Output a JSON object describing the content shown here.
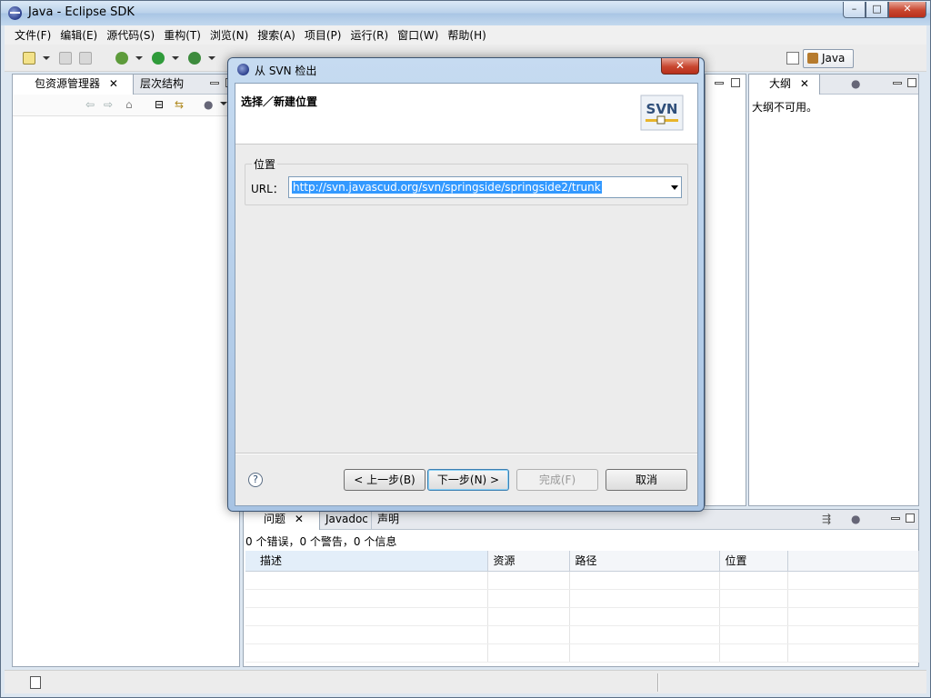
{
  "window": {
    "title": "Java  -  Eclipse SDK"
  },
  "menu": [
    "文件(F)",
    "编辑(E)",
    "源代码(S)",
    "重构(T)",
    "浏览(N)",
    "搜索(A)",
    "项目(P)",
    "运行(R)",
    "窗口(W)",
    "帮助(H)"
  ],
  "perspective": {
    "label": "Java"
  },
  "views": {
    "package_explorer": {
      "tab": "包资源管理器",
      "tab2": "层次结构"
    },
    "outline": {
      "tab": "大纲",
      "message": "大纲不可用。"
    },
    "problems": {
      "tabs": [
        "问题",
        "Javadoc",
        "声明"
      ],
      "summary": "0 个错误，0 个警告，0 个信息",
      "columns": [
        "描述",
        "资源",
        "路径",
        "位置"
      ]
    }
  },
  "dialog": {
    "title": "从 SVN 检出",
    "banner_title": "选择／新建位置",
    "logo_text": "SVN",
    "group_label": "位置",
    "url_label": "URL：",
    "url_value": "http://svn.javascud.org/svn/springside/springside2/trunk",
    "buttons": {
      "back": "< 上一步(B)",
      "next": "下一步(N) >",
      "finish": "完成(F)",
      "cancel": "取消"
    },
    "help": "?"
  },
  "colors": {
    "selection": "#3399ff",
    "title_bar": "#b9d1ea",
    "close_button": "#c8462f"
  }
}
